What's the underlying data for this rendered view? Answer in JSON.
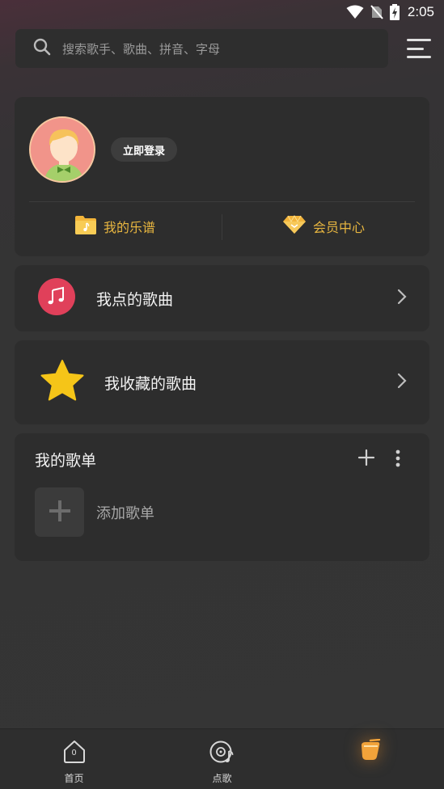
{
  "status_bar": {
    "time": "2:05"
  },
  "search": {
    "placeholder": "搜索歌手、歌曲、拼音、字母"
  },
  "profile": {
    "login_label": "立即登录",
    "links": [
      {
        "label": "我的乐谱",
        "icon": "folder-music-icon"
      },
      {
        "label": "会员中心",
        "icon": "diamond-icon"
      }
    ]
  },
  "my_songs": {
    "label": "我点的歌曲",
    "icon": "music-note-icon"
  },
  "favorites": {
    "label": "我收藏的歌曲",
    "icon": "star-icon"
  },
  "playlists": {
    "title": "我的歌单",
    "add_label": "添加歌单"
  },
  "bottom_nav": {
    "items": [
      {
        "label": "首页",
        "icon": "home-icon",
        "badge": "0"
      },
      {
        "label": "点歌",
        "icon": "vinyl-music-icon"
      },
      {
        "label": "",
        "icon": "mine-cup-icon"
      }
    ]
  },
  "colors": {
    "accent": "#e8b640",
    "pink": "#e0405a",
    "star": "#f5c518",
    "background": "#343434",
    "card": "#2d2d2d"
  }
}
